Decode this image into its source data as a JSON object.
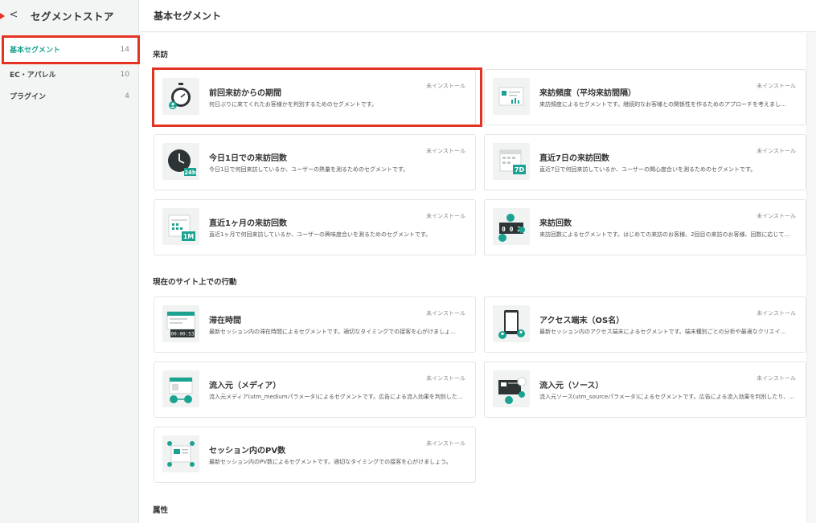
{
  "sidebar": {
    "back_label": "<",
    "title": "セグメントストア",
    "items": [
      {
        "label": "基本セグメント",
        "count": "14"
      },
      {
        "label": "EC・アパレル",
        "count": "10"
      },
      {
        "label": "プラグイン",
        "count": "4"
      }
    ]
  },
  "main": {
    "page_title": "基本セグメント",
    "sections": [
      {
        "title": "来訪",
        "cards": [
          {
            "title": "前回来訪からの期間",
            "desc": "何日ぶりに来てくれたお客様かを判別するためのセグメントです。",
            "status": "未インストール",
            "icon": "stopwatch-icon"
          },
          {
            "title": "来訪頻度（平均来訪間隔）",
            "desc": "来訪頻度によるセグメントです。継続的なお客様との関係性を作るためのアプローチを考えまし…",
            "status": "未インストール",
            "icon": "frequency-chart-icon"
          },
          {
            "title": "今日1日での来訪回数",
            "desc": "今日1日で何回来訪しているか、ユーザーの熱量を測るためのセグメントです。",
            "status": "未インストール",
            "icon": "clock-24h-icon"
          },
          {
            "title": "直近7日の来訪回数",
            "desc": "直近7日で何回来訪しているか、ユーザーの関心度合いを測るためのセグメントです。",
            "status": "未インストール",
            "icon": "calendar-7d-icon"
          },
          {
            "title": "直近1ヶ月の来訪回数",
            "desc": "直近1ヶ月で何回来訪しているか、ユーザーの興味度合いを測るためのセグメントです。",
            "status": "未インストール",
            "icon": "calendar-1m-icon"
          },
          {
            "title": "来訪回数",
            "desc": "来訪回数によるセグメントです。はじめての来訪のお客様、2回目の来訪のお客様、回数に応じて…",
            "status": "未インストール",
            "icon": "counter-icon"
          }
        ]
      },
      {
        "title": "現在のサイト上での行動",
        "cards": [
          {
            "title": "滞在時間",
            "desc": "最新セッション内の滞在時間によるセグメントです。適切なタイミングでの接客を心がけましょ…",
            "status": "未インストール",
            "icon": "stay-time-icon",
            "timer": "00:00:53"
          },
          {
            "title": "アクセス端末（OS名）",
            "desc": "最新セッション内のアクセス端末によるセグメントです。端末種別ごとの分析や最適なクリエイ…",
            "status": "未インストール",
            "icon": "device-icon"
          },
          {
            "title": "流入元（メディア）",
            "desc": "流入元メディア(utm_mediumパラメータ)によるセグメントです。広告による流入効果を判別した…",
            "status": "未インストール",
            "icon": "media-source-icon"
          },
          {
            "title": "流入元（ソース）",
            "desc": "流入元ソース(utm_sourceパラメータ)によるセグメントです。広告による流入効果を判別したり、…",
            "status": "未インストール",
            "icon": "social-source-icon"
          },
          {
            "title": "セッション内のPV数",
            "desc": "最新セッション内のPV数によるセグメントです。適切なタイミングでの接客を心がけましょう。",
            "status": "未インストール",
            "icon": "pageview-icon"
          }
        ]
      },
      {
        "title": "属性",
        "cards": []
      }
    ]
  },
  "thumb_text": {
    "h24": "24h",
    "d7": "7D",
    "m1": "1M",
    "counter": "0 0 2"
  },
  "colors": {
    "accent": "#1ba392",
    "highlight": "#e53323",
    "dark": "#2d3436"
  }
}
